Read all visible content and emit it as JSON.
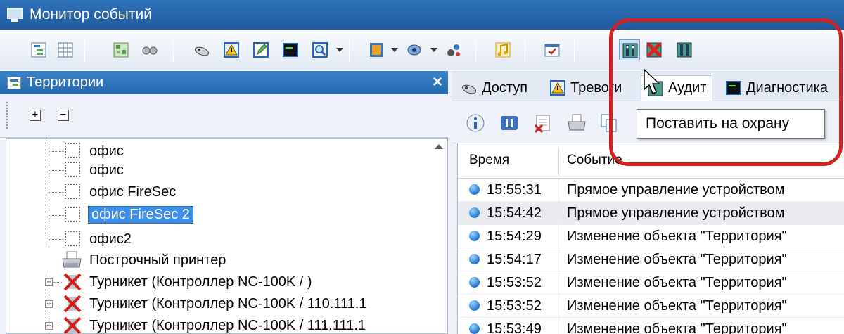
{
  "window": {
    "title": "Монитор событий",
    "app_icon": "monitor-icon"
  },
  "toolbar": {
    "buttons": [
      {
        "icon": "tree-view-icon"
      },
      {
        "icon": "grid-view-icon"
      },
      {
        "icon": "map-icon"
      },
      {
        "icon": "glasses-icon"
      },
      {
        "icon": "access-icon"
      },
      {
        "icon": "alarm-icon"
      },
      {
        "icon": "edit-icon"
      },
      {
        "icon": "diagnostics-icon"
      },
      {
        "icon": "search-icon"
      },
      {
        "icon": "door-icon"
      },
      {
        "icon": "camera-icon"
      },
      {
        "icon": "tools-icon"
      },
      {
        "icon": "music-icon"
      },
      {
        "icon": "checkbox-icon"
      },
      {
        "icon": "arm-guard-icon"
      },
      {
        "icon": "disarm-icon"
      },
      {
        "icon": "guard-status-icon"
      }
    ]
  },
  "territories": {
    "title": "Территории",
    "close_label": "×",
    "expand_all": "+",
    "collapse_all": "−",
    "items": [
      {
        "label": "офис",
        "icon": "zone-icon"
      },
      {
        "label": "офис",
        "icon": "zone-icon"
      },
      {
        "label": "офис FireSec",
        "icon": "zone-icon"
      },
      {
        "label": "офис FireSec 2",
        "icon": "zone-icon",
        "selected": true
      },
      {
        "label": "офис2",
        "icon": "zone-icon"
      },
      {
        "label": "Построчный принтер",
        "icon": "printer-icon"
      },
      {
        "label": "Турникет (Контроллер NC-100K / )",
        "icon": "turnstile-error-icon"
      },
      {
        "label": "Турникет (Контроллер NC-100K / 110.111.1",
        "icon": "turnstile-error-icon"
      },
      {
        "label": "Турникет (Контроллер NC-100K / 111.111.1",
        "icon": "turnstile-error-icon"
      }
    ]
  },
  "tabs": [
    {
      "label": "Доступ",
      "icon": "access-icon"
    },
    {
      "label": "Тревоги",
      "icon": "alarm-icon"
    },
    {
      "label": "Аудит",
      "icon": "audit-icon",
      "active": true
    },
    {
      "label": "Диагностика",
      "icon": "diagnostics-icon"
    }
  ],
  "events": {
    "columns": {
      "time": "Время",
      "event": "Событие"
    },
    "rows": [
      {
        "time": "15:55:31",
        "event": "Прямое управление устройством"
      },
      {
        "time": "15:54:42",
        "event": "Прямое управление устройством"
      },
      {
        "time": "15:54:29",
        "event": "Изменение объекта \"Территория\""
      },
      {
        "time": "15:54:17",
        "event": "Изменение объекта \"Территория\""
      },
      {
        "time": "15:53:52",
        "event": "Изменение объекта \"Территория\""
      },
      {
        "time": "15:53:52",
        "event": "Изменение объекта \"Территория\""
      },
      {
        "time": "15:53:49",
        "event": "Изменение объекта \"Территория\""
      }
    ]
  },
  "tooltip": {
    "text": "Поставить на охрану"
  },
  "colors": {
    "highlight": "#d32121",
    "selection": "#3d8ee8",
    "titlebar": "#2f72b8"
  }
}
